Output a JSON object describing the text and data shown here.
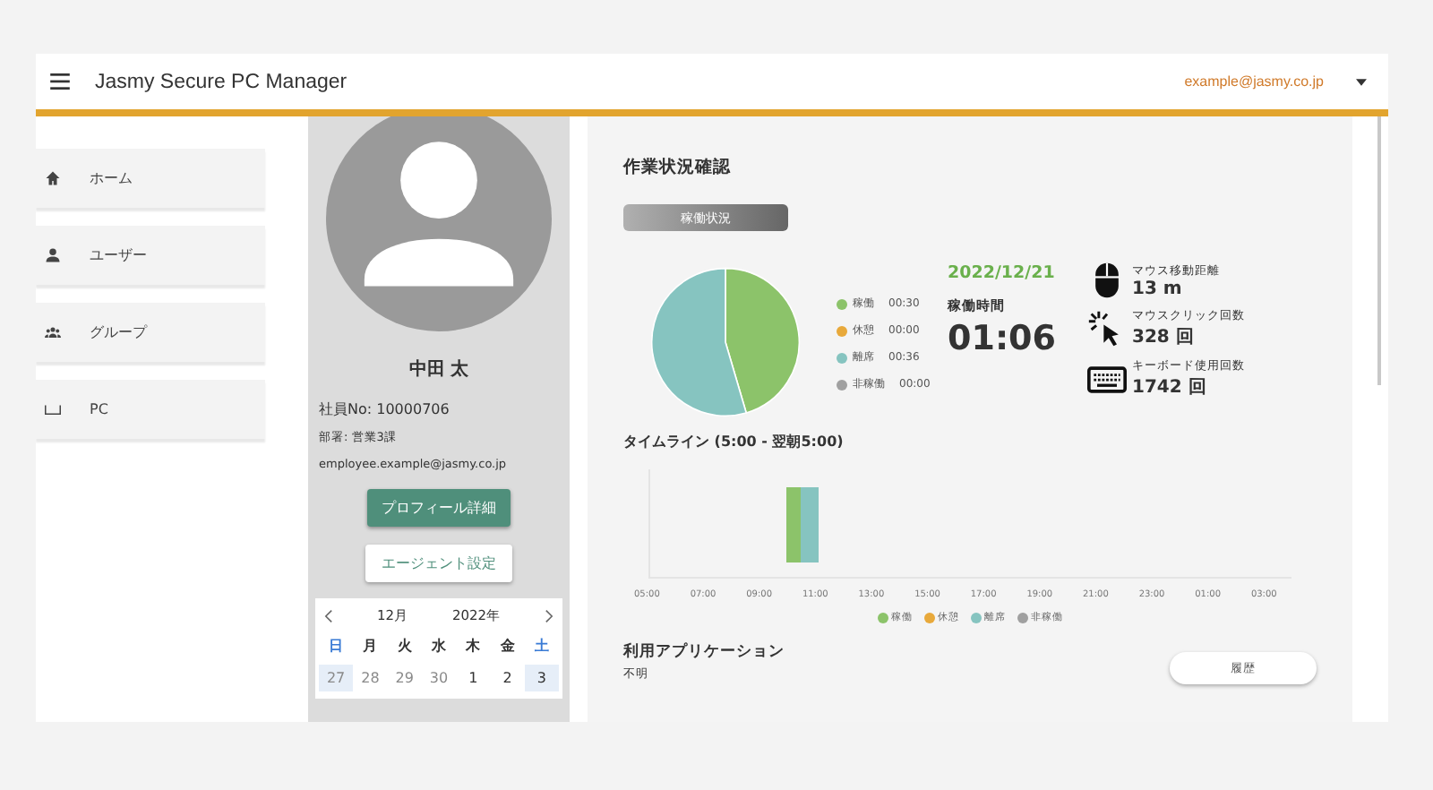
{
  "header": {
    "title": "Jasmy Secure PC Manager",
    "account": "example@jasmy.co.jp"
  },
  "sidebar": {
    "items": [
      {
        "label": "ホーム",
        "kind": "home",
        "selected": false
      },
      {
        "label": "ユーザー",
        "kind": "user",
        "selected": false
      },
      {
        "label": "グループ",
        "kind": "group",
        "selected": false
      },
      {
        "label": "PC",
        "kind": "pc",
        "selected": false
      }
    ]
  },
  "profile": {
    "name": "中田 太",
    "employee_no": "社員No: 10000706",
    "department": "部署: 営業3課",
    "email": "employee.example@jasmy.co.jp",
    "primary_button": "プロフィール詳細",
    "secondary_button": "エージェント設定"
  },
  "calendar": {
    "month": "12月",
    "year": "2022年",
    "weekdays": [
      "日",
      "月",
      "火",
      "水",
      "木",
      "金",
      "土"
    ],
    "days": [
      {
        "label": "27",
        "outside": true,
        "selected": true
      },
      {
        "label": "28",
        "outside": true,
        "selected": false
      },
      {
        "label": "29",
        "outside": true,
        "selected": false
      },
      {
        "label": "30",
        "outside": true,
        "selected": false
      },
      {
        "label": "1",
        "outside": false,
        "selected": false
      },
      {
        "label": "2",
        "outside": false,
        "selected": false
      },
      {
        "label": "3",
        "outside": false,
        "selected": true
      }
    ]
  },
  "work": {
    "title": "作業状況確認",
    "badge": "稼働状況",
    "legend": [
      {
        "time": "00:30",
        "color": "#8cc36a"
      },
      {
        "time": "00:00",
        "color": "#e8a93b"
      },
      {
        "time": "00:36",
        "color": "#86c4c0"
      },
      {
        "time": "00:00",
        "color": "#a0a0a0"
      }
    ],
    "chart_data": {
      "type": "pie",
      "categories": [
        "稼働",
        "休憩",
        "離席",
        "非稼働"
      ],
      "values": [
        45.45,
        0,
        54.55,
        0
      ]
    },
    "date": "2022/12/21",
    "uptime_label": "稼働時間",
    "uptime": "01:06",
    "stats": [
      {
        "kind": "mouse",
        "label": "マウス移動距離",
        "value": "13 m"
      },
      {
        "kind": "click",
        "label": "マウスクリック回数",
        "value": "328 回"
      },
      {
        "kind": "keyboard",
        "label": "キーボード使用回数",
        "value": "1742 回"
      }
    ]
  },
  "timeline": {
    "title": "タイムライン (5:00 - 翌朝5:00)",
    "ticks": [
      "05:00",
      "07:00",
      "09:00",
      "11:00",
      "13:00",
      "15:00",
      "17:00",
      "19:00",
      "21:00",
      "23:00",
      "01:00",
      "03:00"
    ],
    "legend": [
      {
        "label": "稼働",
        "color": "#8cc36a"
      },
      {
        "label": "休憩",
        "color": "#e8a93b"
      },
      {
        "label": "離席",
        "color": "#86c4c0"
      },
      {
        "label": "非稼働",
        "color": "#a0a0a0"
      }
    ]
  },
  "apps": {
    "title": "利用アプリケーション",
    "value": "不明",
    "button": "履歴"
  }
}
